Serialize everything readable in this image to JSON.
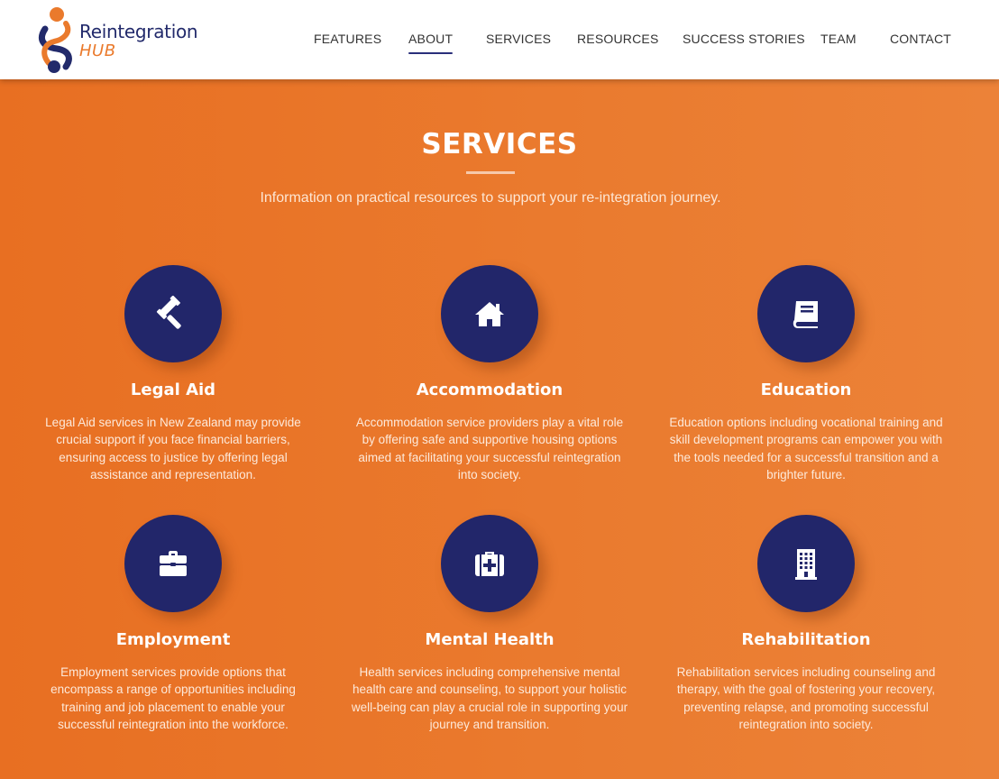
{
  "brand": {
    "name_line1": "Reintegration",
    "name_line2": "HUB",
    "primary_color": "#22266a",
    "accent_color": "#ea7a2c"
  },
  "nav": {
    "items": [
      {
        "label": "FEATURES",
        "active": false
      },
      {
        "label": "ABOUT",
        "active": true
      },
      {
        "label": "SERVICES",
        "active": false
      },
      {
        "label": "RESOURCES",
        "active": false
      },
      {
        "label": "SUCCESS STORIES",
        "active": false
      },
      {
        "label": "TEAM",
        "active": false
      },
      {
        "label": "CONTACT",
        "active": false
      }
    ]
  },
  "section": {
    "title": "SERVICES",
    "subtitle": "Information on practical resources to support your re-integration journey."
  },
  "services": [
    {
      "icon": "gavel-icon",
      "title": "Legal Aid",
      "description": "Legal Aid services in New Zealand may provide crucial support if you face financial barriers, ensuring access to justice by offering legal assistance and representation."
    },
    {
      "icon": "home-icon",
      "title": "Accommodation",
      "description": "Accommodation service providers play a vital role by offering safe and supportive housing options aimed at facilitating your successful reintegration into society."
    },
    {
      "icon": "book-icon",
      "title": "Education",
      "description": "Education options including vocational training and skill development programs can empower you with the tools needed for a successful transition and a brighter future."
    },
    {
      "icon": "briefcase-icon",
      "title": "Employment",
      "description": "Employment services provide options that encompass a range of opportunities including training and job placement to enable your successful reintegration into the workforce."
    },
    {
      "icon": "medical-kit-icon",
      "title": "Mental Health",
      "description": "Health services including comprehensive mental health care and counseling, to support your holistic well-being can play a crucial role in supporting your journey and transition."
    },
    {
      "icon": "building-icon",
      "title": "Rehabilitation",
      "description": "Rehabilitation services including counseling and therapy, with the goal of fostering your recovery, preventing relapse, and promoting successful reintegration into society."
    }
  ]
}
